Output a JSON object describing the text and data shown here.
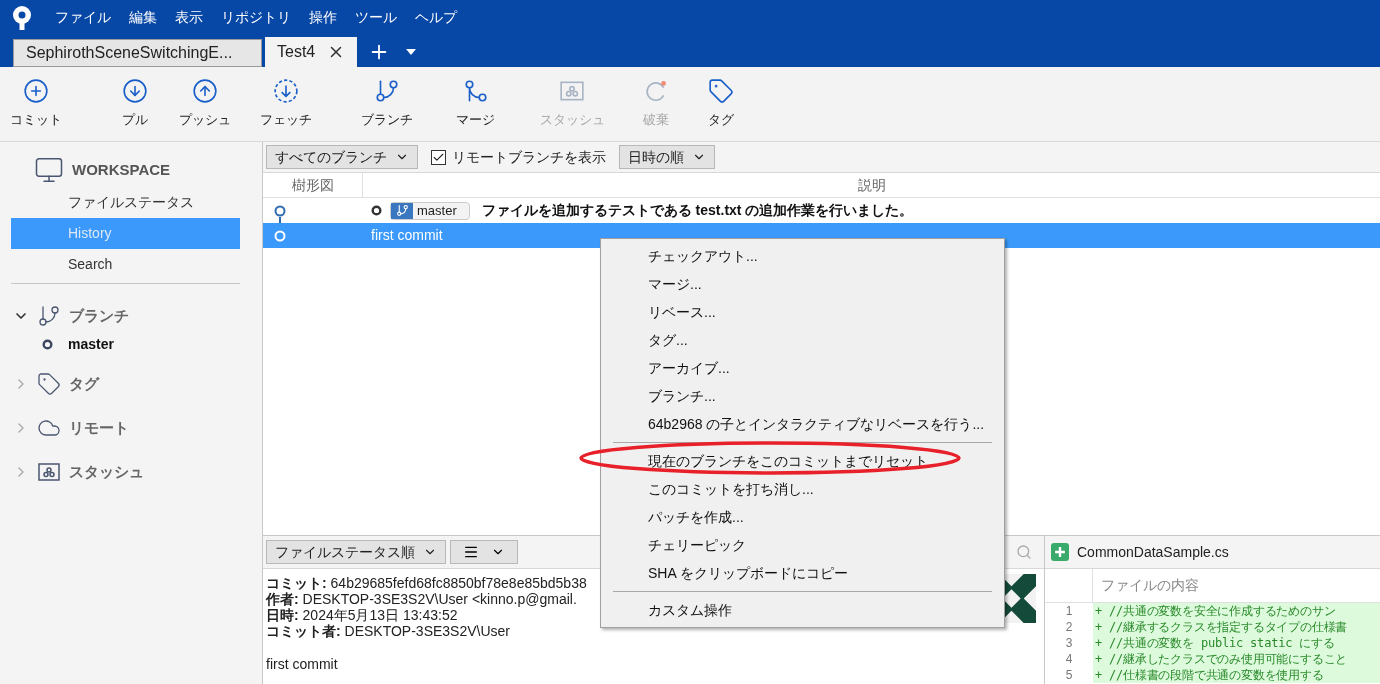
{
  "app_menu": [
    "ファイル",
    "編集",
    "表示",
    "リポジトリ",
    "操作",
    "ツール",
    "ヘルプ"
  ],
  "tabs": [
    {
      "label": "SephirothSceneSwitchingE...",
      "selected": false,
      "closable": false
    },
    {
      "label": "Test4",
      "selected": true,
      "closable": true
    }
  ],
  "toolbar": [
    {
      "kind": "commit",
      "label": "コミット",
      "disabled": false
    },
    {
      "kind": "pull",
      "label": "プル",
      "disabled": false
    },
    {
      "kind": "push",
      "label": "プッシュ",
      "disabled": false
    },
    {
      "kind": "fetch",
      "label": "フェッチ",
      "disabled": false
    },
    {
      "kind": "branch",
      "label": "ブランチ",
      "disabled": false
    },
    {
      "kind": "merge",
      "label": "マージ",
      "disabled": false
    },
    {
      "kind": "stash",
      "label": "スタッシュ",
      "disabled": true
    },
    {
      "kind": "discard",
      "label": "破棄",
      "disabled": true
    },
    {
      "kind": "tag",
      "label": "タグ",
      "disabled": false
    }
  ],
  "sidebar": {
    "workspace": {
      "title": "WORKSPACE",
      "items": [
        {
          "label": "ファイルステータス",
          "selected": false
        },
        {
          "label": "History",
          "selected": true
        },
        {
          "label": "Search",
          "selected": false
        }
      ]
    },
    "groups": [
      {
        "kind": "branch",
        "label": "ブランチ",
        "expanded": true,
        "children": [
          {
            "label": "master"
          }
        ]
      },
      {
        "kind": "tag",
        "label": "タグ",
        "expanded": false
      },
      {
        "kind": "remote",
        "label": "リモート",
        "expanded": false
      },
      {
        "kind": "stash",
        "label": "スタッシュ",
        "expanded": false
      }
    ]
  },
  "history": {
    "branch_filter": "すべてのブランチ",
    "show_remote": {
      "label": "リモートブランチを表示",
      "checked": true
    },
    "sort": "日時の順",
    "columns": [
      "樹形図",
      "説明"
    ],
    "rows": [
      {
        "branch": "master",
        "message": "ファイルを追加するテストである test.txt の追加作業を行いました。",
        "selected": false
      },
      {
        "message": "first commit",
        "selected": true
      }
    ]
  },
  "context_menu": [
    [
      "チェックアウト...",
      "マージ...",
      "リベース...",
      "タグ...",
      "アーカイブ...",
      "ブランチ...",
      "64b2968 の子とインタラクティブなリベースを行う..."
    ],
    [
      "現在のブランチをこのコミットまでリセット",
      "このコミットを打ち消し...",
      "パッチを作成...",
      "チェリーピック",
      "SHA をクリップボードにコピー"
    ],
    [
      "カスタム操作"
    ]
  ],
  "details": {
    "sort": "ファイルステータス順",
    "lines": [
      "**コミット:** 64b29685fefd68fc8850bf78e8e85bd5b38",
      "**作者:** DESKTOP-3SE3S2V\\User <kinno.p@gmail.",
      "**日時:** 2024年5月13日 13:43:52",
      "**コミット者:** DESKTOP-3SE3S2V\\User"
    ],
    "message": "first commit"
  },
  "file": {
    "name": "CommonDataSample.cs",
    "column": "ファイルの内容",
    "lines": [
      {
        "number": "1",
        "text": "+ //共通の変数を安全に作成するためのサン"
      },
      {
        "number": "2",
        "text": "+ //継承するクラスを指定するタイプの仕様書"
      },
      {
        "number": "3",
        "text": "+ //共通の変数を public static にする"
      },
      {
        "number": "4",
        "text": "+ //継承したクラスでのみ使用可能にすること"
      },
      {
        "number": "5",
        "text": "+ //仕様書の段階で共通の変数を使用する"
      }
    ]
  }
}
